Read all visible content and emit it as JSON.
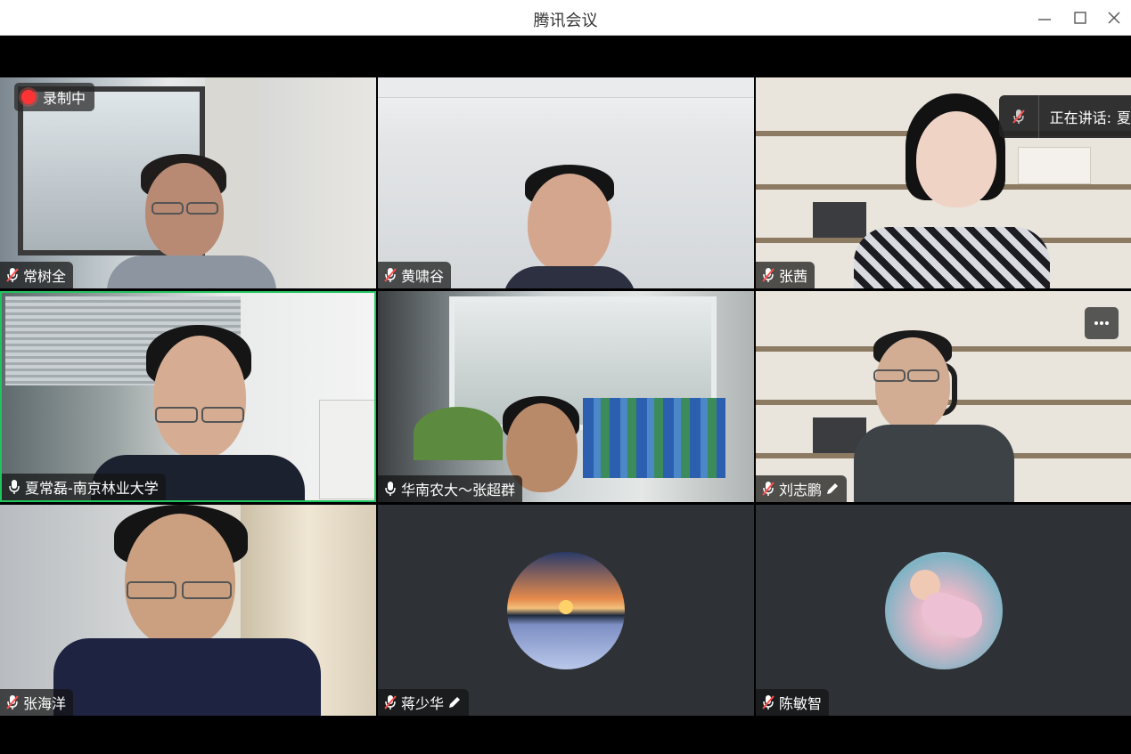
{
  "window": {
    "title": "腾讯会议"
  },
  "recording": {
    "label": "录制中"
  },
  "speaking": {
    "label": "正在讲话:",
    "name": "夏"
  },
  "participants": [
    {
      "name": "常树全",
      "muted": true
    },
    {
      "name": "黄啸谷",
      "muted": true
    },
    {
      "name": "张茜",
      "muted": true
    },
    {
      "name": "夏常磊-南京林业大学",
      "muted": false,
      "active": true
    },
    {
      "name": "华南农大～张超群",
      "muted": false
    },
    {
      "name": "刘志鹏",
      "muted": true,
      "editing": true
    },
    {
      "name": "张海洋",
      "muted": true
    },
    {
      "name": "蒋少华",
      "muted": true,
      "editing": true
    },
    {
      "name": "陈敏智",
      "muted": true
    }
  ],
  "colors": {
    "active_border": "#21c55d",
    "recording": "#ff3333",
    "muted": "#ff4d4d"
  }
}
